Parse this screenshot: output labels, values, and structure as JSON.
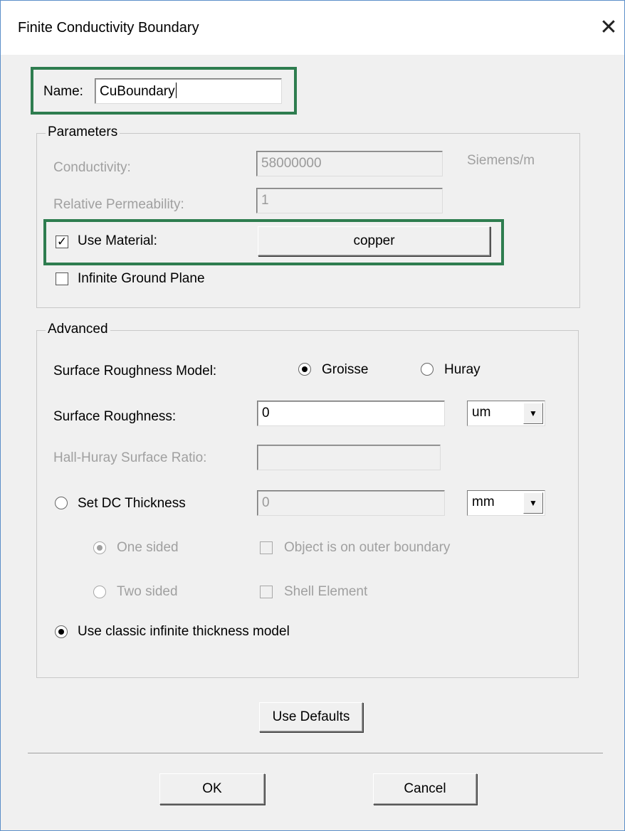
{
  "window": {
    "title": "Finite Conductivity Boundary",
    "close_icon": "close-icon"
  },
  "name": {
    "label": "Name:",
    "value": "CuBoundary"
  },
  "parameters": {
    "group_label": "Parameters",
    "conductivity_label": "Conductivity:",
    "conductivity_value": "58000000",
    "conductivity_unit": "Siemens/m",
    "permeability_label": "Relative Permeability:",
    "permeability_value": "1",
    "use_material_label": "Use Material:",
    "use_material_checked": true,
    "material_button": "copper",
    "infinite_ground_label": "Infinite Ground Plane",
    "infinite_ground_checked": false
  },
  "advanced": {
    "group_label": "Advanced",
    "roughness_model_label": "Surface Roughness Model:",
    "groisse_label": "Groisse",
    "huray_label": "Huray",
    "selected_model": "Groisse",
    "roughness_label": "Surface Roughness:",
    "roughness_value": "0",
    "roughness_unit": "um",
    "hall_huray_label": "Hall-Huray Surface Ratio:",
    "hall_huray_value": "",
    "set_dc_label": "Set DC Thickness",
    "dc_value": "0",
    "dc_unit": "mm",
    "one_sided_label": "One sided",
    "two_sided_label": "Two sided",
    "outer_boundary_label": "Object is on outer boundary",
    "shell_element_label": "Shell Element",
    "classic_label": "Use classic infinite thickness model"
  },
  "buttons": {
    "use_defaults": "Use Defaults",
    "ok": "OK",
    "cancel": "Cancel"
  },
  "colors": {
    "highlight": "#2e7d4f",
    "window_border": "#5c8fc9",
    "dialog_bg": "#f0f0f0"
  }
}
